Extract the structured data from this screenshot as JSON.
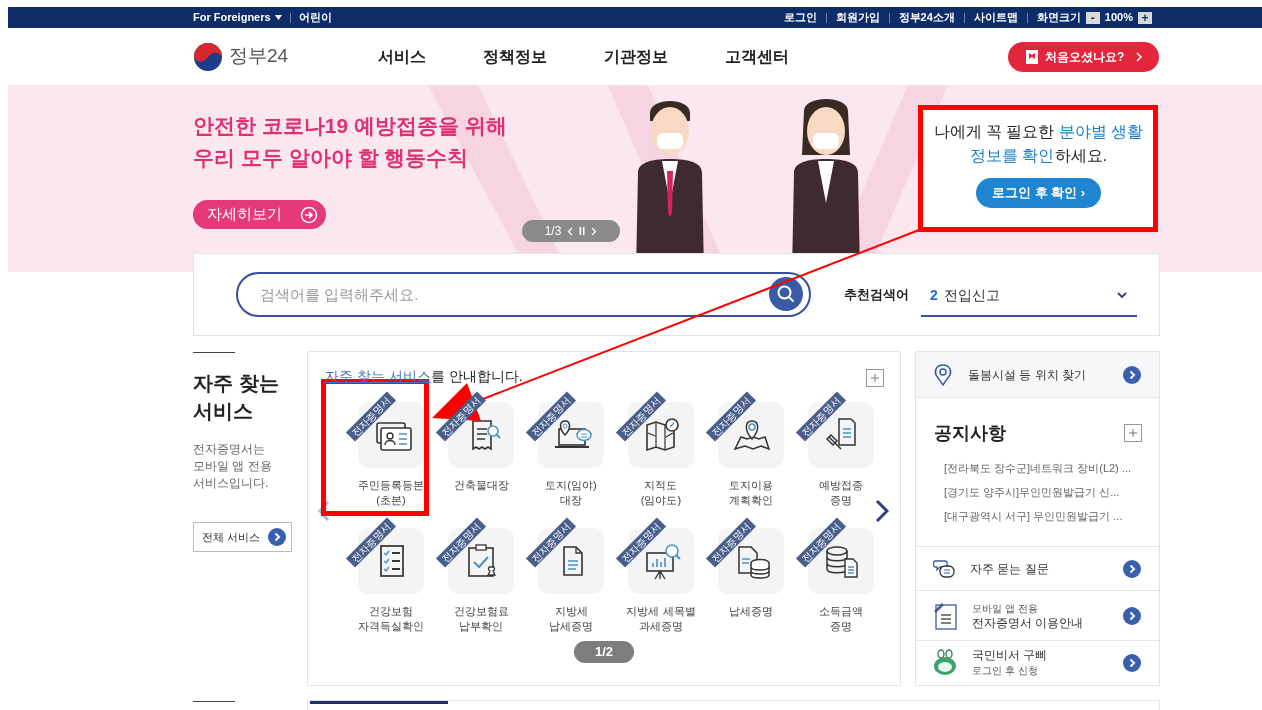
{
  "top_bar": {
    "left": [
      {
        "label": "For Foreigners",
        "kind": "dropdown"
      },
      {
        "label": "어린이",
        "kind": "link"
      }
    ],
    "right": [
      "로그인",
      "회원가입",
      "정부24소개",
      "사이트맵"
    ],
    "font_size": {
      "label": "화면크기",
      "minus": "-",
      "value": "100%",
      "plus": "+"
    }
  },
  "header": {
    "logo": "정부24",
    "nav": [
      "서비스",
      "정책정보",
      "기관정보",
      "고객센터"
    ],
    "first_visit": "처음오셨나요?"
  },
  "banner": {
    "headline": [
      "안전한 코로나19 예방접종을 위해",
      "우리 모두 알아야 할 행동수칙"
    ],
    "button": "자세히보기",
    "pager": "1/3",
    "login_card": {
      "text": "나에게 꼭 필요한 **분야별 생활 정보를 확인**하세요.",
      "button": "로그인 후 확인 ›"
    }
  },
  "search": {
    "placeholder": "검색어를 입력해주세요.",
    "recommend_label": "추천검색어",
    "rank": "2",
    "term": "전입신고"
  },
  "frequent": {
    "title": "자주 찾는 서비스",
    "description": "전자증명서는 모바일 앱 전용 서비스입니다.",
    "all_button": "전체 서비스"
  },
  "services": {
    "heading": "**자주 찾는 서비스**를 안내합니다.",
    "pager": "1/2",
    "tiles": [
      {
        "label": "주민등록등본\n(초본)",
        "badge": "전자증명서",
        "kind": "id-card"
      },
      {
        "label": "건축물대장",
        "badge": "전자증명서",
        "kind": "receipt-search"
      },
      {
        "label": "토지(임야)\n대장",
        "badge": "전자증명서",
        "kind": "laptop-pin"
      },
      {
        "label": "지적도\n(임야도)",
        "badge": "전자증명서",
        "kind": "map-search"
      },
      {
        "label": "토지이용\n계획확인",
        "badge": "전자증명서",
        "kind": "map-pin"
      },
      {
        "label": "예방접종\n증명",
        "badge": "전자증명서",
        "kind": "syringe-document"
      },
      {
        "label": "건강보험\n자격득실확인",
        "badge": "전자증명서",
        "kind": "checklist"
      },
      {
        "label": "건강보험료\n납부확인",
        "badge": "전자증명서",
        "kind": "clipboard-stamp"
      },
      {
        "label": "지방세\n납세증명",
        "badge": "전자증명서",
        "kind": "document"
      },
      {
        "label": "지방세 세목별\n과세증명",
        "badge": "전자증명서",
        "kind": "chart-search"
      },
      {
        "label": "납세증명",
        "badge": "전자증명서",
        "kind": "document-database"
      },
      {
        "label": "소득금액\n증명",
        "badge": "전자증명서",
        "kind": "database-document"
      }
    ]
  },
  "side": {
    "location": "돌봄시설 등 위치 찾기",
    "notices": {
      "title": "공지사항",
      "items": [
        "[전라북도 장수군]네트워크 장비(L2) ...",
        "[경기도 양주시]무인민원발급기 신...",
        "[대구광역시 서구] 무인민원발급기 ..."
      ]
    },
    "faq": "자주 묻는 질문",
    "mobile": {
      "line1": "모바일 앱 전용",
      "line2": "전자증명서 이용안내"
    },
    "assistant": {
      "title": "국민비서 구삐",
      "subtitle": "로그인 후 신청"
    }
  }
}
